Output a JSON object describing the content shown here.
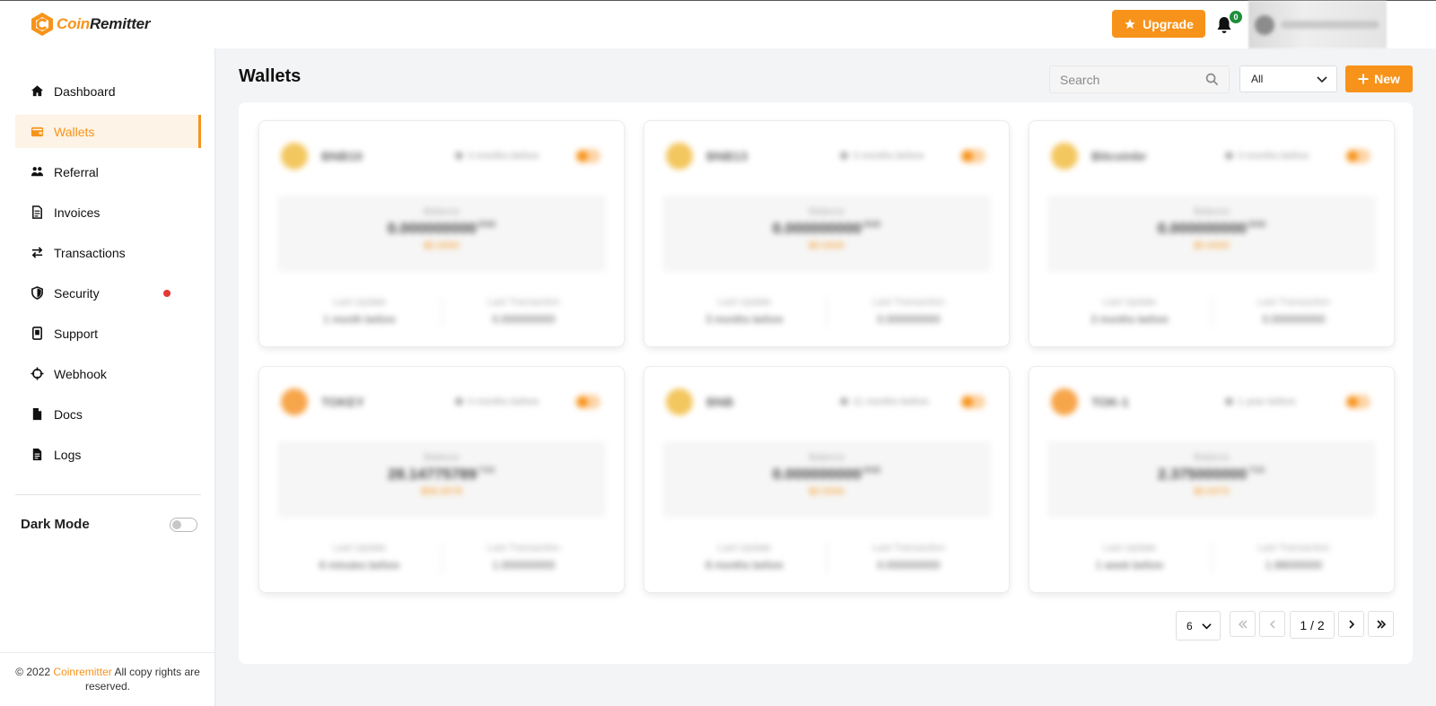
{
  "brand": {
    "name_part1": "Coin",
    "name_part2": "Remitter",
    "accent": "#f7931a"
  },
  "header": {
    "upgrade_label": "Upgrade",
    "notification_count": "0"
  },
  "sidebar": {
    "items": [
      {
        "label": "Dashboard",
        "icon": "home-icon"
      },
      {
        "label": "Wallets",
        "icon": "wallet-icon",
        "active": true
      },
      {
        "label": "Referral",
        "icon": "users-icon"
      },
      {
        "label": "Invoices",
        "icon": "invoice-icon"
      },
      {
        "label": "Transactions",
        "icon": "transfer-icon"
      },
      {
        "label": "Security",
        "icon": "shield-icon",
        "alert": true
      },
      {
        "label": "Support",
        "icon": "support-icon"
      },
      {
        "label": "Webhook",
        "icon": "crosshair-icon"
      },
      {
        "label": "Docs",
        "icon": "document-icon"
      },
      {
        "label": "Logs",
        "icon": "log-file-icon"
      }
    ],
    "dark_mode_label": "Dark Mode",
    "dark_mode_on": false
  },
  "footer": {
    "prefix": "© 2022 ",
    "brand": "Coinremitter",
    "suffix": " All copy rights are reserved."
  },
  "main": {
    "title": "Wallets",
    "search_placeholder": "Search",
    "filter_value": "All",
    "new_label": "New"
  },
  "wallets": [
    {
      "coin": "BNB10",
      "ago": "3 months before",
      "balance_label": "Balance",
      "balance": "0.000000000",
      "unit": "BNB",
      "usd": "$0.0000",
      "last_update_label": "Last Update",
      "last_update": "1 month before",
      "last_tx_label": "Last Transaction",
      "last_tx": "0.000000000",
      "color": "#f3c75f"
    },
    {
      "coin": "BNB13",
      "ago": "3 months before",
      "balance_label": "Balance",
      "balance": "0.000000000",
      "unit": "BNB",
      "usd": "$0.0000",
      "last_update_label": "Last Update",
      "last_update": "3 months before",
      "last_tx_label": "Last Transaction",
      "last_tx": "0.000000000",
      "color": "#f3c75f"
    },
    {
      "coin": "Bitcoinbr",
      "ago": "3 months before",
      "balance_label": "Balance",
      "balance": "0.000000000",
      "unit": "BNB",
      "usd": "$0.0000",
      "last_update_label": "Last Update",
      "last_update": "3 months before",
      "last_tx_label": "Last Transaction",
      "last_tx": "0.000000000",
      "color": "#f3c75f"
    },
    {
      "coin": "TOKEY",
      "ago": "4 months before",
      "balance_label": "Balance",
      "balance": "28.14775789",
      "unit": "TOK",
      "usd": "$58.9578",
      "last_update_label": "Last Update",
      "last_update": "6 minutes before",
      "last_tx_label": "Last Transaction",
      "last_tx": "1.000000000",
      "color": "#f7a54a"
    },
    {
      "coin": "BNB",
      "ago": "11 months before",
      "balance_label": "Balance",
      "balance": "0.000000000",
      "unit": "BNB",
      "usd": "$0.0000",
      "last_update_label": "Last Update",
      "last_update": "8 months before",
      "last_tx_label": "Last Transaction",
      "last_tx": "0.000000000",
      "color": "#f3c75f"
    },
    {
      "coin": "TOK-1",
      "ago": "1 year before",
      "balance_label": "Balance",
      "balance": "2.375000000",
      "unit": "TOK",
      "usd": "$0.0070",
      "last_update_label": "Last Update",
      "last_update": "1 week before",
      "last_tx_label": "Last Transaction",
      "last_tx": "1.98000000",
      "color": "#f7a54a"
    }
  ],
  "pagination": {
    "per_page": "6",
    "page_info": "1 / 2"
  }
}
